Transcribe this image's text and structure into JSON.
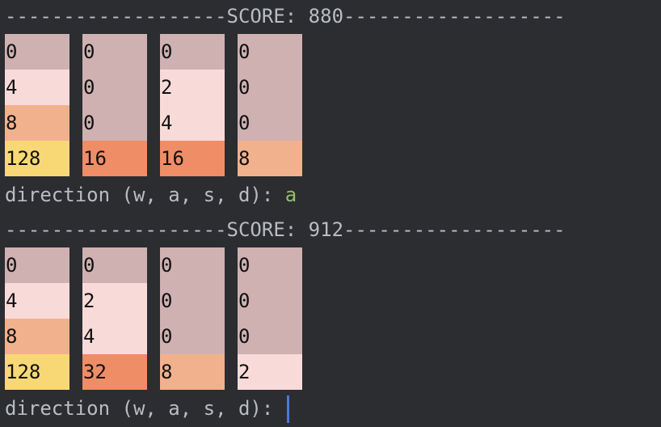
{
  "rounds": [
    {
      "score_line": "-------------------SCORE: 880-------------------",
      "board": [
        [
          0,
          4,
          8,
          128
        ],
        [
          0,
          0,
          0,
          16
        ],
        [
          0,
          2,
          4,
          16
        ],
        [
          0,
          0,
          0,
          8
        ]
      ],
      "prompt": "direction (w, a, s, d): ",
      "input": "a"
    },
    {
      "score_line": "-------------------SCORE: 912-------------------",
      "board": [
        [
          0,
          4,
          8,
          128
        ],
        [
          0,
          2,
          4,
          32
        ],
        [
          0,
          0,
          0,
          8
        ],
        [
          0,
          0,
          0,
          2
        ]
      ],
      "prompt": "direction (w, a, s, d): ",
      "input": ""
    }
  ],
  "colors": {
    "tile_0": "#d0b1b1",
    "tile_2": "#f8dbd9",
    "tile_4": "#f8dbd9",
    "tile_8": "#f2b18d",
    "tile_16": "#ef8d67",
    "tile_32": "#ef8d67",
    "tile_128": "#f8d875",
    "input_text": "#8fbf72",
    "cursor": "#4b78d8"
  }
}
